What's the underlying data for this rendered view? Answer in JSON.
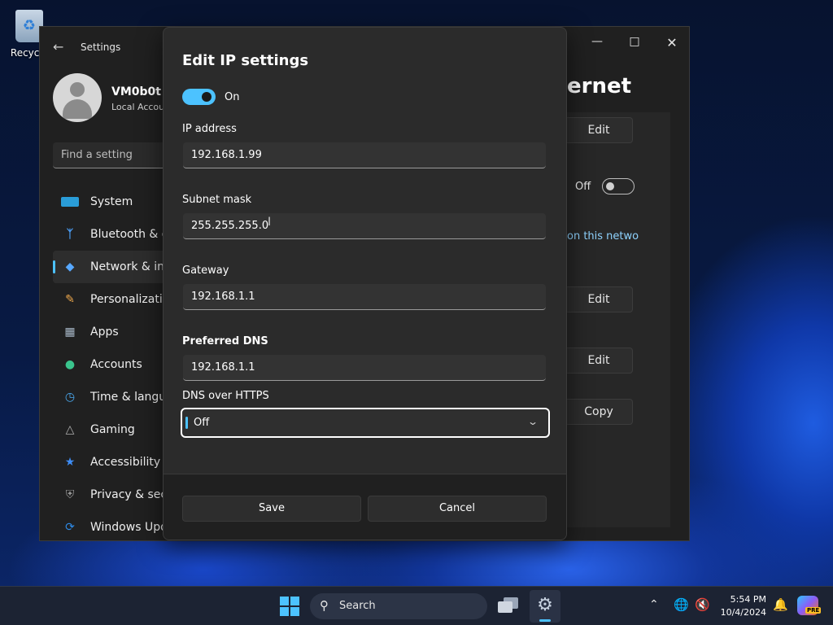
{
  "desktop": {
    "recycle_bin_label": "Recycle"
  },
  "settings_window": {
    "title": "Settings",
    "profile": {
      "name": "VM0b0t",
      "account_type": "Local Accou"
    },
    "search_placeholder": "Find a setting",
    "nav_items": [
      {
        "label": "System",
        "icon": "system-icon"
      },
      {
        "label": "Bluetooth & de",
        "icon": "bluetooth-icon"
      },
      {
        "label": "Network & inte",
        "icon": "network-icon"
      },
      {
        "label": "Personalization",
        "icon": "brush-icon"
      },
      {
        "label": "Apps",
        "icon": "apps-icon"
      },
      {
        "label": "Accounts",
        "icon": "accounts-icon"
      },
      {
        "label": "Time & langua",
        "icon": "globe-clock-icon"
      },
      {
        "label": "Gaming",
        "icon": "gamepad-icon"
      },
      {
        "label": "Accessibility",
        "icon": "accessibility-icon"
      },
      {
        "label": "Privacy & secur",
        "icon": "shield-icon"
      },
      {
        "label": "Windows Upda",
        "icon": "update-icon"
      }
    ],
    "active_nav_index": 2,
    "right_title": "ernet",
    "right_buttons": {
      "edit1": "Edit",
      "edit2": "Edit",
      "edit3": "Edit",
      "copy": "Copy"
    },
    "metered_toggle_label": "Off",
    "partial_link": "on this netwo"
  },
  "dialog": {
    "title": "Edit IP settings",
    "toggle_label": "On",
    "ip_address_label": "IP address",
    "ip_address_value": "192.168.1.99",
    "subnet_label": "Subnet mask",
    "subnet_value": "255.255.255.0",
    "gateway_label": "Gateway",
    "gateway_value": "192.168.1.1",
    "preferred_dns_label": "Preferred DNS",
    "preferred_dns_value": "192.168.1.1",
    "doh_label": "DNS over HTTPS",
    "doh_value": "Off",
    "save_label": "Save",
    "cancel_label": "Cancel"
  },
  "taskbar": {
    "search_label": "Search",
    "time": "5:54 PM",
    "date": "10/4/2024",
    "copilot_badge": "PRE"
  },
  "colors": {
    "accent": "#4cc2ff",
    "window_bg": "#202020",
    "dialog_bg": "#2b2b2b"
  }
}
